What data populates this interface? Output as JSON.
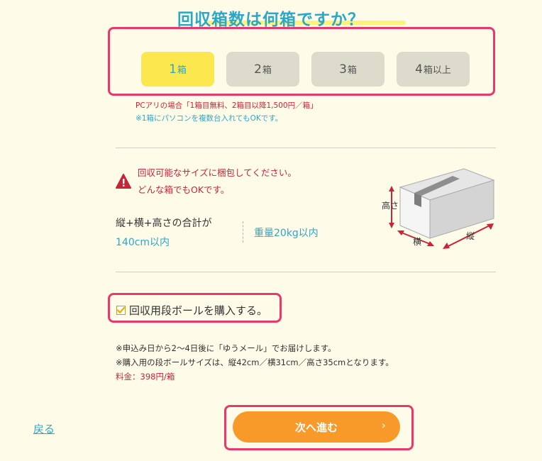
{
  "title": "回収箱数は何箱ですか？",
  "box_options": [
    {
      "num": "1",
      "unit": "箱",
      "selected": true
    },
    {
      "num": "2",
      "unit": "箱",
      "selected": false
    },
    {
      "num": "3",
      "unit": "箱",
      "selected": false
    },
    {
      "num": "4",
      "unit": "箱以上",
      "selected": false
    }
  ],
  "notes": {
    "pc_price": "PCアリの場合「1箱目無料、2箱目以降1,500円／箱」",
    "pc_multi": "※1箱にパソコンを複数台入れてもOKです。"
  },
  "warning": {
    "line1": "回収可能なサイズに梱包してください。",
    "line2": "どんな箱でもOKです。"
  },
  "size": {
    "line1": "縦+横+高さの合計が",
    "line2": "140cm以内",
    "weight": "重量20kg以内"
  },
  "box_diagram": {
    "height_label": "高さ",
    "width_label": "横",
    "depth_label": "縦"
  },
  "purchase": {
    "checked": true,
    "label": "回収用段ボールを購入する。"
  },
  "delivery": {
    "line1": "※申込み日から2〜4日後に「ゆうメール」でお届けします。",
    "line2": "※購入用の段ボールサイズは、縦42cm／横31cm／高さ35cmとなります。",
    "price": "料金：398円/箱"
  },
  "nav": {
    "back": "戻る",
    "next": "次へ進む",
    "next_arrow": "›"
  },
  "colors": {
    "accent_blue": "#2aa8c8",
    "selected_yellow": "#fbe84e",
    "next_orange": "#f79a2a",
    "warning_red": "#c8243a",
    "highlight_pink": "#e8386c"
  }
}
